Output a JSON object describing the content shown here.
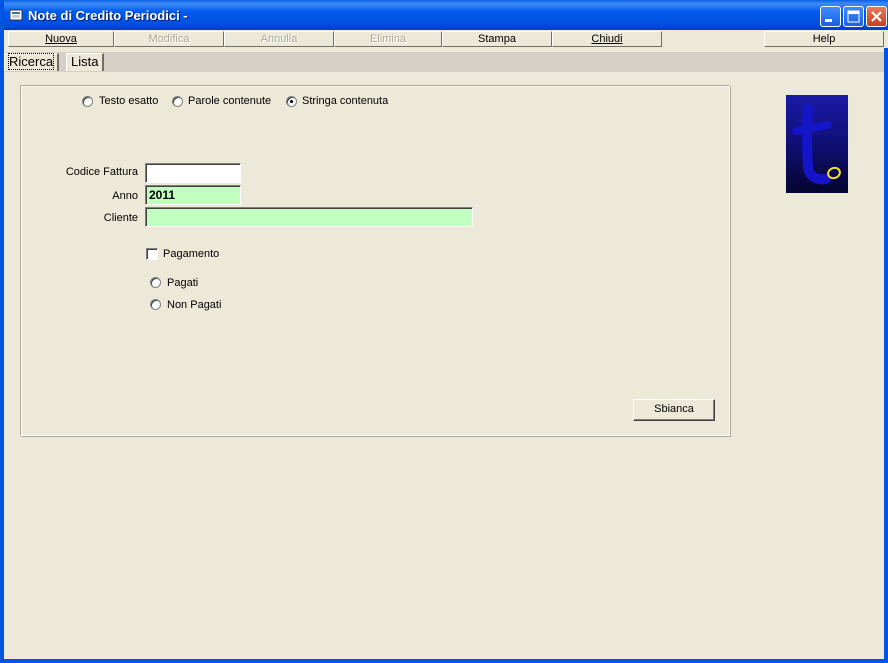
{
  "window": {
    "title": "Note di Credito Periodici -",
    "colors": {
      "titlebar": "#0054e3",
      "field_highlight": "#c0ffc0",
      "face": "#ece9d8"
    }
  },
  "toolbar": {
    "nuova": "Nuova",
    "modifica": "Modifica",
    "annulla": "Annulla",
    "elimina": "Elimina",
    "stampa": "Stampa",
    "chiudi": "Chiudi",
    "help": "Help"
  },
  "tabs": {
    "ricerca": "Ricerca",
    "lista": "Lista"
  },
  "search_mode": {
    "options": [
      "Testo esatto",
      "Parole contenute",
      "Stringa contenuta"
    ],
    "selected": "Stringa contenuta"
  },
  "form": {
    "codice_fattura_label": "Codice Fattura",
    "codice_fattura_value": "",
    "anno_label": "Anno",
    "anno_value": "2011",
    "cliente_label": "Cliente",
    "cliente_value": "",
    "pagamento_label": "Pagamento",
    "pagamento_checked": false,
    "pagati_label": "Pagati",
    "non_pagati_label": "Non Pagati"
  },
  "buttons": {
    "sbianca": "Sbianca"
  },
  "logo": {
    "icon": "app-logo-t"
  }
}
